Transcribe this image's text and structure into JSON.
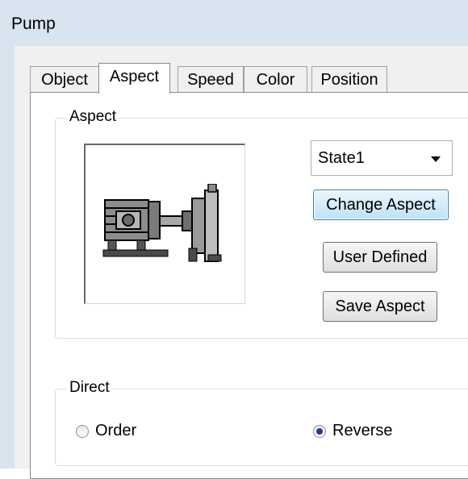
{
  "window": {
    "title": "Pump"
  },
  "tabs": [
    {
      "label": "Object",
      "active": false
    },
    {
      "label": "Aspect",
      "active": true
    },
    {
      "label": "Speed",
      "active": false
    },
    {
      "label": "Color",
      "active": false
    },
    {
      "label": "Position",
      "active": false
    }
  ],
  "aspect_group": {
    "label": "Aspect",
    "preview_icon": "pump-motor-icon",
    "state_select": {
      "value": "State1"
    },
    "buttons": {
      "change": "Change Aspect",
      "user_defined": "User Defined",
      "save": "Save Aspect"
    }
  },
  "direct_group": {
    "label": "Direct",
    "options": [
      {
        "label": "Order",
        "checked": false
      },
      {
        "label": "Reverse",
        "checked": true
      }
    ]
  }
}
